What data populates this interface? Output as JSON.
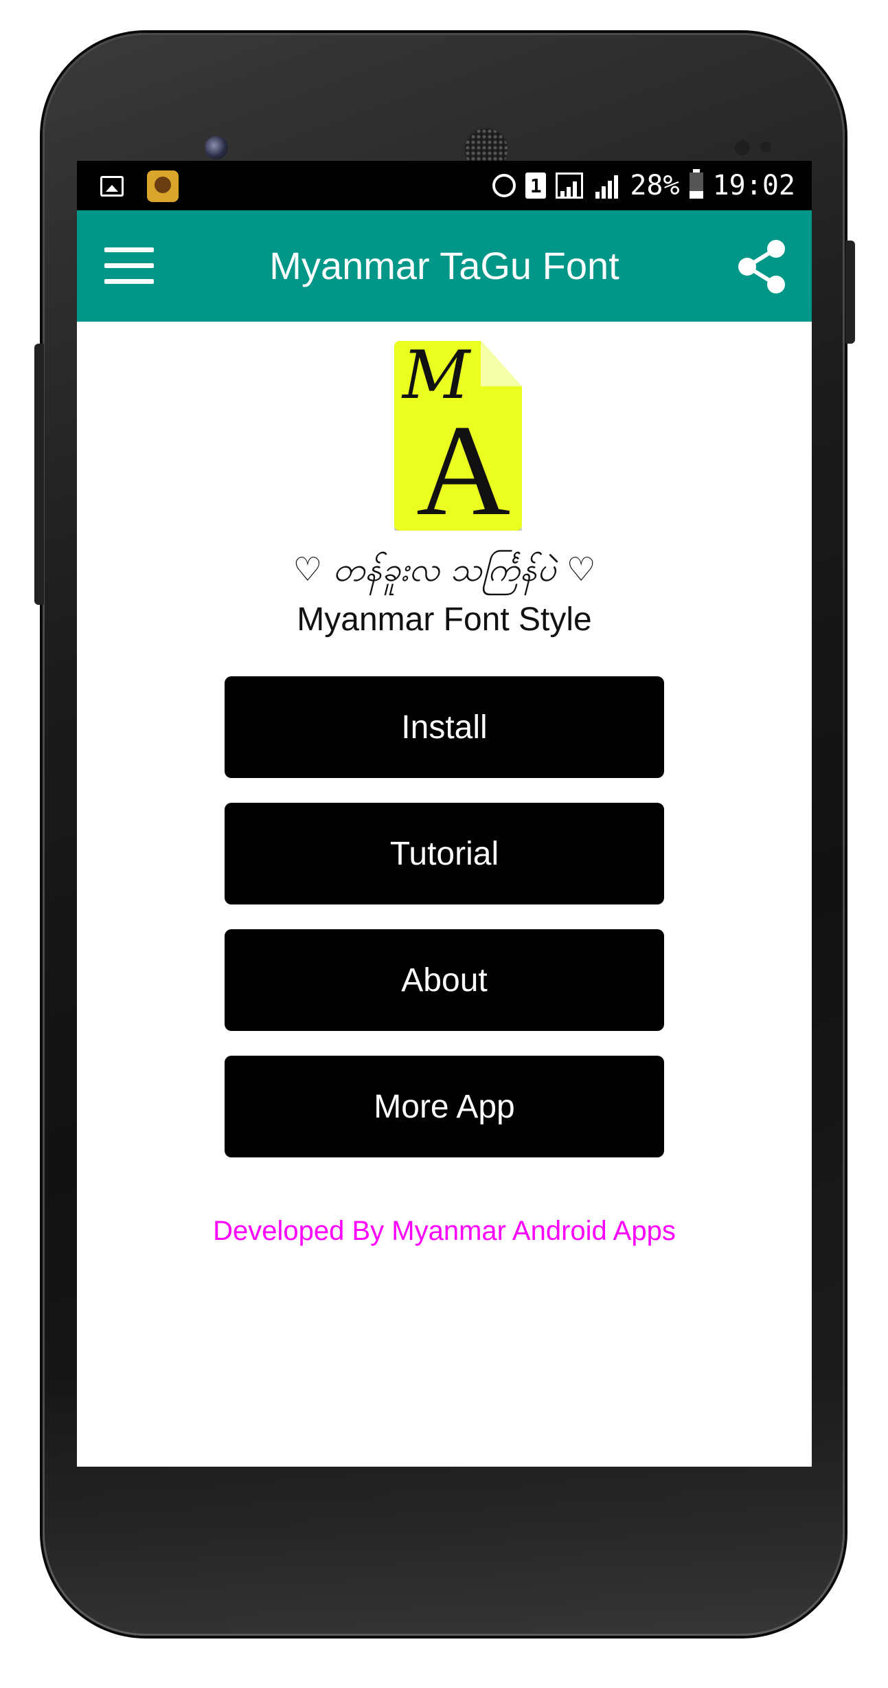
{
  "status_bar": {
    "battery": "28%",
    "time": "19:02",
    "sim_slot": "1"
  },
  "app_bar": {
    "title": "Myanmar TaGu Font",
    "menu_icon": "hamburger-menu-icon",
    "share_icon": "share-icon",
    "color": "#009688"
  },
  "logo": {
    "letter_top": "M",
    "letter_main": "A",
    "color": "#eaff1f"
  },
  "tagline": "♡ တန်ခူးလ သင်္ကြန်ပဲ ♡",
  "subtitle": "Myanmar Font Style",
  "buttons": [
    {
      "label": "Install"
    },
    {
      "label": "Tutorial"
    },
    {
      "label": "About"
    },
    {
      "label": "More App"
    }
  ],
  "footer": {
    "text": "Developed By Myanmar Android Apps",
    "color": "#ff00ff"
  }
}
